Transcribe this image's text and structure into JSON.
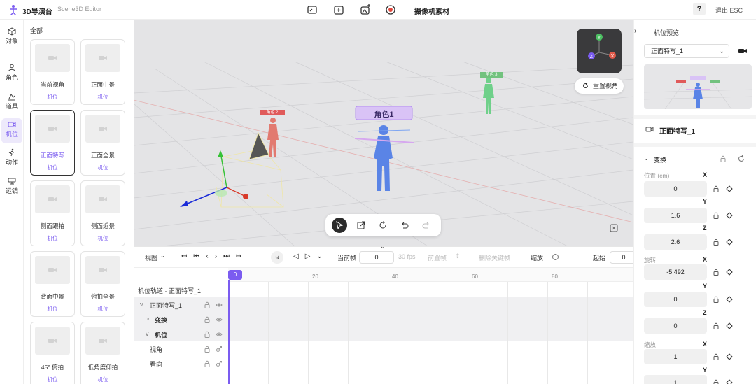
{
  "topbar": {
    "app_name": "3D导演台",
    "editor_name": "Scene3D Editor",
    "center_title": "摄像机素材",
    "help": "?",
    "exit": "退出 ESC",
    "icons": [
      "screen-icon",
      "add-icon",
      "media-add-icon",
      "record-icon"
    ]
  },
  "rail": {
    "items": [
      {
        "label": "对象",
        "icon": "cube-icon"
      },
      {
        "label": "角色",
        "icon": "person-icon"
      },
      {
        "label": "道具",
        "icon": "prop-icon"
      },
      {
        "label": "机位",
        "icon": "camera-icon",
        "active": true
      },
      {
        "label": "动作",
        "icon": "run-icon"
      },
      {
        "label": "运镜",
        "icon": "camera-move-icon"
      }
    ]
  },
  "library": {
    "heading": "全部",
    "cards": [
      {
        "name": "当前视角",
        "tag": "机位"
      },
      {
        "name": "正面中景",
        "tag": "机位"
      },
      {
        "name": "正面特写",
        "tag": "机位",
        "selected": true
      },
      {
        "name": "正面全景",
        "tag": "机位"
      },
      {
        "name": "侧面跟拍",
        "tag": "机位"
      },
      {
        "name": "侧面近景",
        "tag": "机位"
      },
      {
        "name": "背面中景",
        "tag": "机位"
      },
      {
        "name": "俯拍全景",
        "tag": "机位"
      },
      {
        "name": "45° 俯拍",
        "tag": "机位"
      },
      {
        "name": "低角度仰拍",
        "tag": "机位"
      }
    ]
  },
  "viewport": {
    "gizmo_axes": [
      "Y",
      "X",
      "Z"
    ],
    "reset_view": "重置视角",
    "characters": [
      {
        "label": "角色1",
        "color": "#c9a6f4"
      },
      {
        "label": "角色 2",
        "color": "#e56b6b"
      },
      {
        "label": "角色 3",
        "color": "#5ec47a"
      }
    ]
  },
  "timeline": {
    "view_label": "视图",
    "current_frame_label": "当前帧",
    "current_frame": "0",
    "fps": "30 fps",
    "prev_key": "前置帧",
    "delete_key": "删除关键帧",
    "zoom_label": "缩放",
    "start_label": "起始",
    "start_value": "0",
    "ruler_ticks": [
      "0",
      "20",
      "40",
      "60",
      "80"
    ],
    "playhead": "0",
    "breadcrumb": "机位轨道 · 正面特写_1",
    "tracks": [
      {
        "label": "正面特写_1",
        "indent": 0,
        "expand": "v"
      },
      {
        "label": "变换",
        "indent": 1,
        "expand": ">",
        "bold": true
      },
      {
        "label": "机位",
        "indent": 1,
        "expand": "v",
        "bold": true
      },
      {
        "label": "视角",
        "indent": 2
      },
      {
        "label": "看向",
        "indent": 2
      }
    ]
  },
  "panel": {
    "title": "机位预览",
    "camera_select": "正面特写_1",
    "object_name": "正面特写_1",
    "transform_label": "变换",
    "position_label": "位置 (cm)",
    "rotation_label": "旋转",
    "scale_label": "缩放",
    "axes": [
      "X",
      "Y",
      "Z"
    ],
    "position": [
      "0",
      "1.6",
      "2.6"
    ],
    "rotation": [
      "-5.492",
      "0",
      "0"
    ],
    "scale": [
      "1",
      "1"
    ]
  }
}
